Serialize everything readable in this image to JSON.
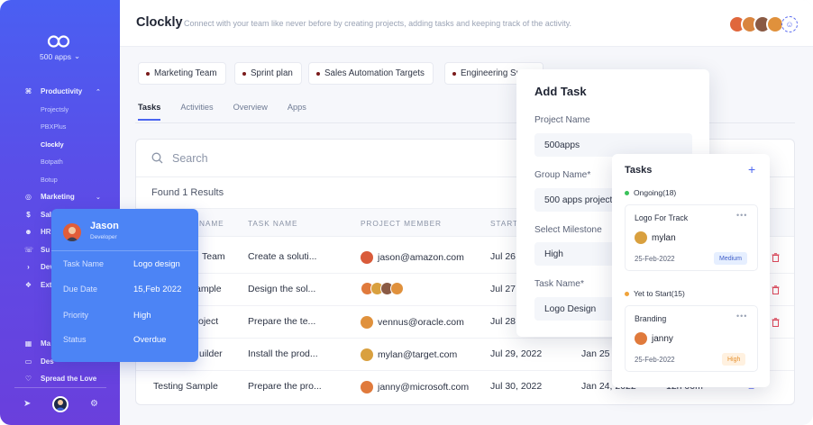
{
  "sidebar": {
    "apps_label": "500 apps",
    "nav": [
      {
        "icon": "grid-icon",
        "label": "Productivity",
        "expanded": true
      },
      {
        "icon": "target-icon",
        "label": "Marketing",
        "expanded": false
      },
      {
        "icon": "dollar-icon",
        "label": "Sal"
      },
      {
        "icon": "users-icon",
        "label": "HR"
      },
      {
        "icon": "headset-icon",
        "label": "Su"
      },
      {
        "icon": "code-icon",
        "label": "Dev"
      },
      {
        "icon": "puzzle-icon",
        "label": "Ext Plu"
      }
    ],
    "sub_items": [
      "Projectsly",
      "PBXPlus",
      "Clockly",
      "Botpath",
      "Botup"
    ],
    "active_sub": "Clockly",
    "bottom": [
      {
        "icon": "apps-icon",
        "label": "Ma"
      },
      {
        "icon": "desktop-icon",
        "label": "Des"
      },
      {
        "icon": "heart-icon",
        "label": "Spread the Love"
      }
    ]
  },
  "header": {
    "title": "Clockly",
    "subtitle": "Connect with your team like never before by creating projects, adding tasks and keeping track of the activity."
  },
  "projects": [
    "Marketing Team",
    "Sprint plan",
    "Sales Automation Targets",
    "Engineering Sp"
  ],
  "tabs": [
    "Tasks",
    "Activities",
    "Overview",
    "Apps"
  ],
  "active_tab": "Tasks",
  "search": {
    "placeholder": "Search"
  },
  "results_text": "Found 1 Results",
  "table": {
    "headers": [
      "NAME",
      "TASK NAME",
      "PROJECT MEMBER",
      "START"
    ],
    "rows": [
      {
        "name": "Team",
        "task": "Create a soluti...",
        "member": "jason@amazon.com",
        "start": "Jul 26",
        "end": "",
        "time": ""
      },
      {
        "name": "ample",
        "task": "Design the sol...",
        "member": "",
        "start": "Jul 27",
        "end": "",
        "time": ""
      },
      {
        "name": "oject",
        "task": "Prepare the te...",
        "member": "vennus@oracle.com",
        "start": "Jul 28",
        "end": "",
        "time": ""
      },
      {
        "name": "uilder",
        "task": "Install the prod...",
        "member": "mylan@target.com",
        "start": "Jul 29, 2022",
        "end": "Jan 25",
        "time": ""
      },
      {
        "name": "Testing Sample",
        "task": "Prepare the pro...",
        "member": "janny@microsoft.com",
        "start": "Jul 30, 2022",
        "end": "Jan 24, 2022",
        "time": "12h 00m"
      }
    ]
  },
  "tooltip": {
    "name": "Jason",
    "role": "Developer",
    "fields": [
      {
        "label": "Task Name",
        "value": "Logo design"
      },
      {
        "label": "Due Date",
        "value": "15,Feb 2022"
      },
      {
        "label": "Priority",
        "value": "High"
      },
      {
        "label": "Status",
        "value": "Overdue"
      }
    ]
  },
  "add_task": {
    "title": "Add Task",
    "project_label": "Project Name",
    "project_value": "500apps",
    "group_label": "Group Name*",
    "group_value": "500 apps project",
    "milestone_label": "Select Milestone",
    "milestone_value": "High",
    "task_label": "Task Name*",
    "task_value": "Logo Design"
  },
  "tasks_panel": {
    "title": "Tasks",
    "add": "+",
    "groups": [
      {
        "status": "Ongoing(18)",
        "color": "#3ac25a",
        "card": {
          "title": "Logo For Track",
          "user": "mylan",
          "date": "25-Feb-2022",
          "priority": "Medium",
          "badge_bg": "#e6efff",
          "badge_fg": "#3f5ec8"
        }
      },
      {
        "status": "Yet to Start(15)",
        "color": "#f0a33a",
        "card": {
          "title": "Branding",
          "user": "janny",
          "date": "25-Feb-2022",
          "priority": "High",
          "badge_bg": "#fff1e0",
          "badge_fg": "#e6902e"
        }
      }
    ]
  },
  "colors": {
    "accent": "#4a64f0",
    "sidebar_top": "#4a5ff2",
    "sidebar_bottom": "#6a3fdc",
    "tooltip": "#4c84f5",
    "trash": "#e0485a"
  }
}
